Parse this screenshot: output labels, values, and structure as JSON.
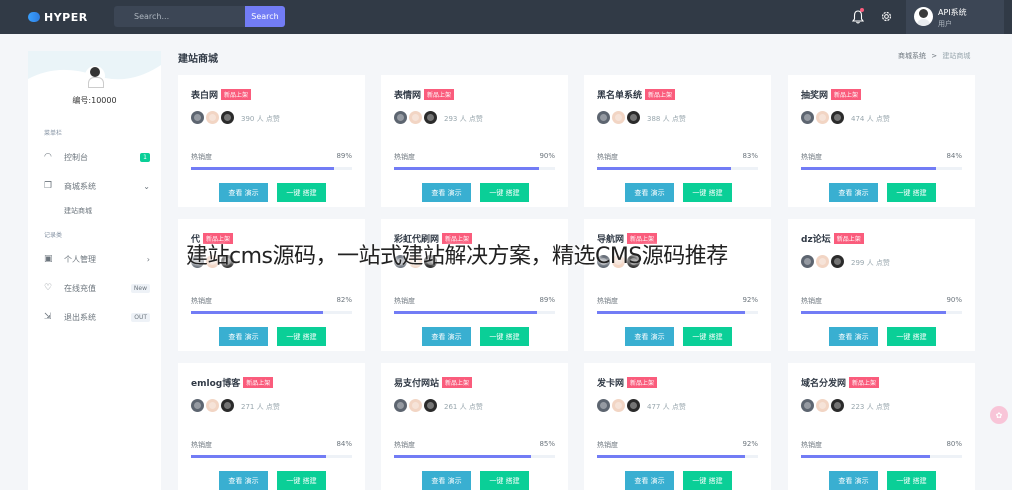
{
  "brand": {
    "name": "HYPER"
  },
  "search": {
    "placeholder": "Search...",
    "button": "Search"
  },
  "user": {
    "name": "API系统",
    "role": "用户"
  },
  "sidebar": {
    "user_id": "编号:10000",
    "section1": "菜单栏",
    "section2": "记录类",
    "items": [
      {
        "label": "控制台",
        "badge": "1",
        "icon": "dashboard-icon"
      },
      {
        "label": "商城系统",
        "icon": "store-icon"
      },
      {
        "label": "个人管理",
        "icon": "briefcase-icon"
      },
      {
        "label": "在线充值",
        "badge": "New",
        "icon": "heart-icon"
      },
      {
        "label": "退出系统",
        "badge": "OUT",
        "icon": "logout-icon"
      }
    ],
    "sub_item": "建站商城"
  },
  "page": {
    "title": "建站商城",
    "breadcrumb_1": "商城系统",
    "breadcrumb_sep": ">",
    "breadcrumb_2": "建站商城"
  },
  "common": {
    "tag": "新品上架",
    "hot_label": "热销度",
    "demo_button": "查看 演示",
    "build_button": "一键 搭建",
    "likes_suffix": "人 点赞"
  },
  "cards": [
    {
      "title": "表白网",
      "likes": "390",
      "hot": "89%",
      "hot_value": 0.89
    },
    {
      "title": "表情网",
      "likes": "293",
      "hot": "90%",
      "hot_value": 0.9
    },
    {
      "title": "黑名单系统",
      "likes": "388",
      "hot": "83%",
      "hot_value": 0.83
    },
    {
      "title": "抽奖网",
      "likes": "474",
      "hot": "84%",
      "hot_value": 0.84
    },
    {
      "title": "代",
      "likes": "",
      "hot": "82%",
      "hot_value": 0.82
    },
    {
      "title": "彩虹代刷网",
      "likes": "",
      "hot": "89%",
      "hot_value": 0.89
    },
    {
      "title": "导航网",
      "likes": "",
      "hot": "92%",
      "hot_value": 0.92
    },
    {
      "title": "dz论坛",
      "likes": "299",
      "hot": "90%",
      "hot_value": 0.9
    },
    {
      "title": "emlog博客",
      "likes": "271",
      "hot": "84%",
      "hot_value": 0.84
    },
    {
      "title": "易支付网站",
      "likes": "261",
      "hot": "85%",
      "hot_value": 0.85
    },
    {
      "title": "发卡网",
      "likes": "477",
      "hot": "92%",
      "hot_value": 0.92
    },
    {
      "title": "域名分发网",
      "likes": "223",
      "hot": "80%",
      "hot_value": 0.8
    }
  ],
  "overlay_text": "建站cms源码，一站式建站解决方案，精选CMS源码推荐",
  "colors": {
    "topbar": "#313a46",
    "accent": "#727cf5",
    "tag": "#fa5c7c",
    "demo": "#39afd1",
    "build": "#0acf97"
  }
}
